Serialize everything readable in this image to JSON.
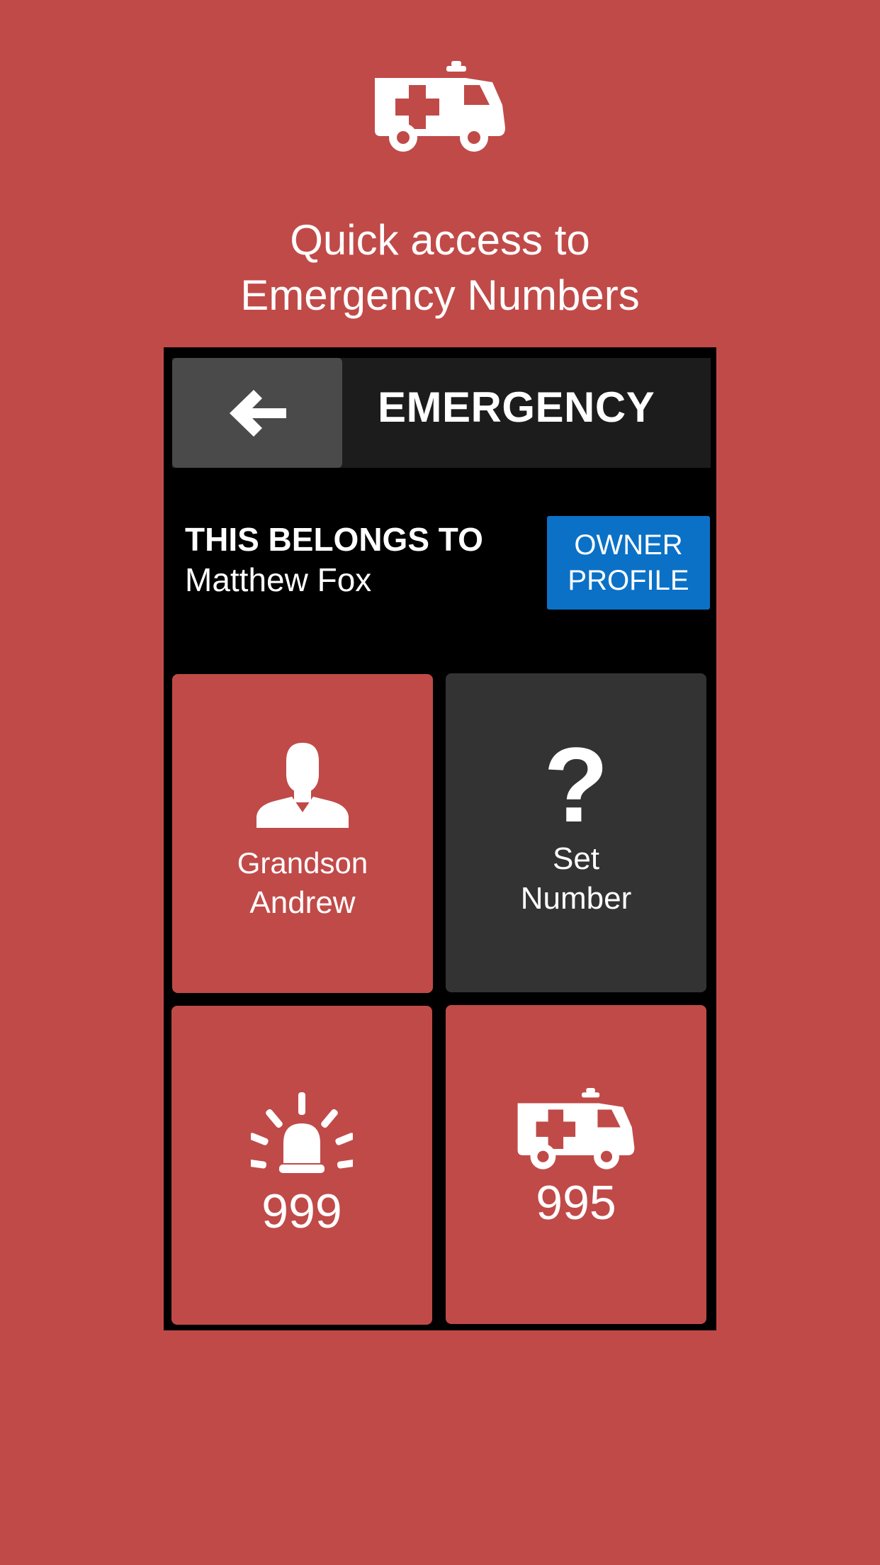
{
  "headline": {
    "line1": "Quick access to",
    "line2": "Emergency Numbers"
  },
  "header": {
    "title": "EMERGENCY"
  },
  "owner": {
    "heading": "THIS BELONGS TO",
    "name": "Matthew Fox",
    "profile_button": {
      "line1": "OWNER",
      "line2": "PROFILE"
    }
  },
  "tiles": [
    {
      "line1": "Grandson",
      "line2": "Andrew",
      "icon": "person-icon",
      "color": "#c04a48"
    },
    {
      "line1": "Set",
      "line2": "Number",
      "icon": "question-mark-icon",
      "color": "#333333"
    },
    {
      "number": "999",
      "icon": "siren-icon",
      "color": "#c04a48"
    },
    {
      "number": "995",
      "icon": "ambulance-icon",
      "color": "#c04a48"
    }
  ],
  "colors": {
    "background": "#c04a48",
    "accent_blue": "#0b71c6",
    "header_bar": "#1c1c1c",
    "back_button": "#4a4a4a"
  }
}
